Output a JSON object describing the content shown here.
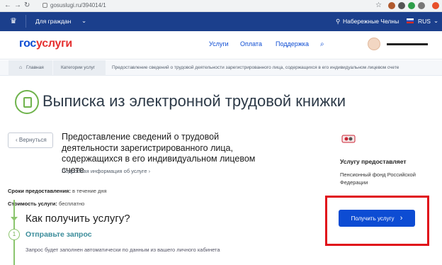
{
  "browser": {
    "url": "gosuslugi.ru/394014/1"
  },
  "topbar": {
    "audience": "Для граждан",
    "city": "Набережные Челны",
    "lang": "RUS"
  },
  "header": {
    "logo_gos": "гос",
    "logo_uslugi": "услуги",
    "menu": [
      "Услуги",
      "Оплата",
      "Поддержка"
    ]
  },
  "breadcrumbs": [
    "Главная",
    "Категории услуг",
    "Предоставление сведений о трудовой деятельности зарегистрированного лица, содержащихся в его индивидуальном лицевом счете"
  ],
  "page": {
    "title": "Выписка из электронной трудовой книжки",
    "back_label": "Вернуться",
    "service_title": "Предоставление сведений о трудовой деятельности зарегистрированного лица, содержащихся в его индивидуальном лицевом счете",
    "detail_link": "Подробная информация об услуге",
    "terms_label": "Сроки предоставления:",
    "terms_value": "в течение дня",
    "cost_label": "Стоимость услуги:",
    "cost_value": "бесплатно",
    "how_title": "Как получить услугу?",
    "step_number": "1",
    "step_title": "Отправьте запрос",
    "step_desc": "Запрос будет заполнен автоматически по данным из вашего личного кабинета"
  },
  "provider": {
    "label": "Услугу предоставляет",
    "name": "Пенсионный фонд Российской Федерации",
    "button": "Получить услугу"
  },
  "colors": {
    "brand_blue": "#0d4cd3",
    "brand_red": "#e53030",
    "topbar": "#1b3f8c",
    "highlight": "#e0101a",
    "step_green": "#8bc56d"
  }
}
